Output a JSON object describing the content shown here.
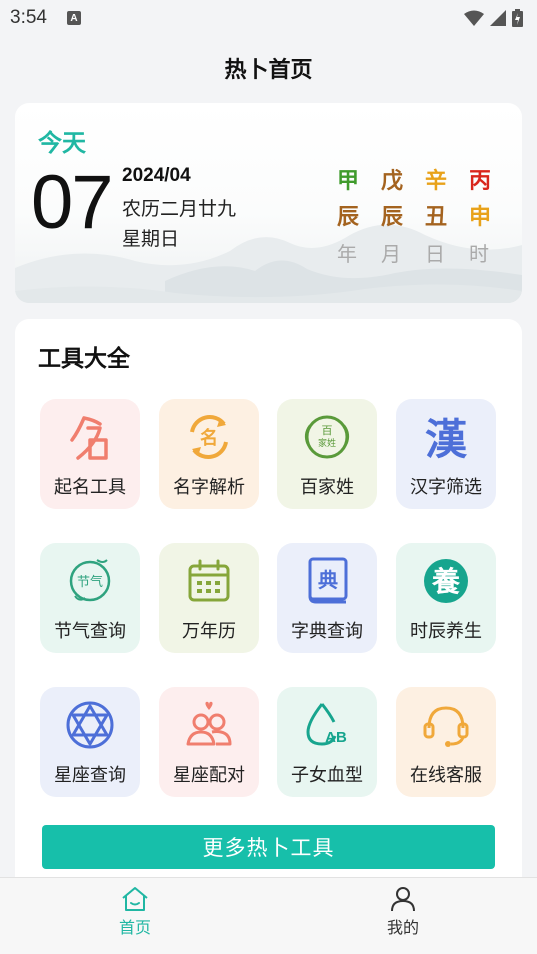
{
  "status": {
    "time": "3:54",
    "notification_icon": "A"
  },
  "header": {
    "title": "热卜首页"
  },
  "today": {
    "label": "今天",
    "day": "07",
    "year_month": "2024/04",
    "lunar": "农历二月廿九",
    "weekday": "星期日",
    "ganzhi": {
      "stems": [
        {
          "char": "甲",
          "color": "#3f9b2c"
        },
        {
          "char": "戊",
          "color": "#a4631f"
        },
        {
          "char": "辛",
          "color": "#e8a21a"
        },
        {
          "char": "丙",
          "color": "#d9261c"
        }
      ],
      "branches": [
        {
          "char": "辰",
          "color": "#a4631f"
        },
        {
          "char": "辰",
          "color": "#a4631f"
        },
        {
          "char": "丑",
          "color": "#a4631f"
        },
        {
          "char": "申",
          "color": "#e8a21a"
        }
      ],
      "units": [
        "年",
        "月",
        "日",
        "时"
      ]
    }
  },
  "tools": {
    "title": "工具大全",
    "items": [
      {
        "label": "起名工具",
        "icon": "naming-icon",
        "bg": "#fdeeee"
      },
      {
        "label": "名字解析",
        "icon": "name-analysis-icon",
        "bg": "#fdf0e2"
      },
      {
        "label": "百家姓",
        "icon": "surname-icon",
        "bg": "#f1f5e6"
      },
      {
        "label": "汉字筛选",
        "icon": "hanzi-icon",
        "bg": "#ebeffa"
      },
      {
        "label": "节气查询",
        "icon": "solar-term-icon",
        "bg": "#e8f6f1"
      },
      {
        "label": "万年历",
        "icon": "calendar-icon",
        "bg": "#f1f5e6"
      },
      {
        "label": "字典查询",
        "icon": "dictionary-icon",
        "bg": "#ebeffa"
      },
      {
        "label": "时辰养生",
        "icon": "health-icon",
        "bg": "#e8f6f1"
      },
      {
        "label": "星座查询",
        "icon": "constellation-icon",
        "bg": "#ebeffa"
      },
      {
        "label": "星座配对",
        "icon": "pairing-icon",
        "bg": "#fdeeee"
      },
      {
        "label": "子女血型",
        "icon": "blood-type-icon",
        "bg": "#e8f6f1"
      },
      {
        "label": "在线客服",
        "icon": "headset-icon",
        "bg": "#fdf0e2"
      }
    ],
    "icon_glyphs": {
      "name": "名",
      "surname_top": "百",
      "surname_bottom": "家姓",
      "hanzi": "漢",
      "dict": "典",
      "jieqi": "节气",
      "yang": "養",
      "ab": "AB"
    },
    "more_label": "更多热卜工具"
  },
  "tabbar": {
    "items": [
      {
        "label": "首页",
        "icon": "home-icon",
        "active": true
      },
      {
        "label": "我的",
        "icon": "user-icon",
        "active": false
      }
    ],
    "active_color": "#20b7a3"
  }
}
